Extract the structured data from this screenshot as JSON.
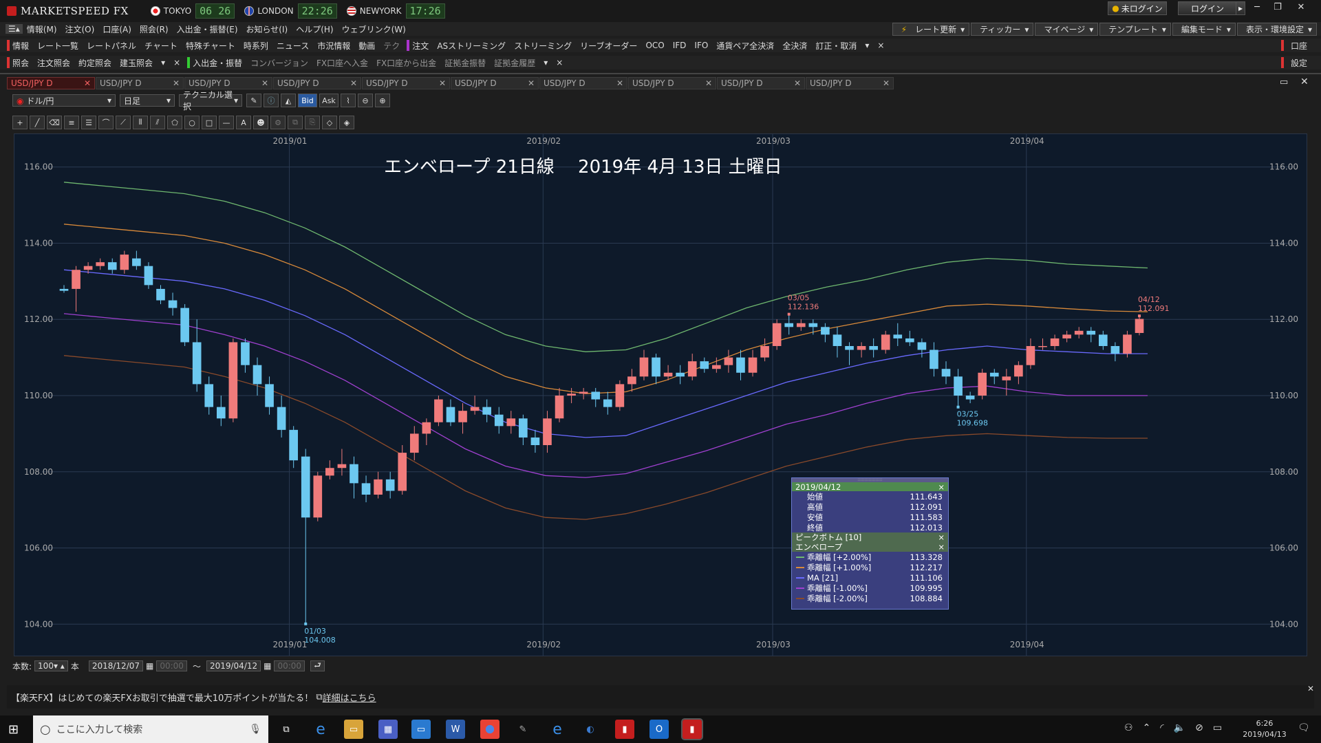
{
  "app": {
    "title": "MARKETSPEED FX"
  },
  "markets": [
    {
      "name": "TOKYO",
      "time": "06 26"
    },
    {
      "name": "LONDON",
      "time": "22:26"
    },
    {
      "name": "NEWYORK",
      "time": "17:26"
    }
  ],
  "top_buttons": {
    "login_status": "未ログイン",
    "login": "ログイン"
  },
  "menu": [
    "情報(M)",
    "注文(O)",
    "口座(A)",
    "照会(R)",
    "入出金・振替(E)",
    "お知らせ(I)",
    "ヘルプ(H)",
    "ウェブリンク(W)"
  ],
  "menu_right": [
    "レート更新",
    "ティッカー",
    "マイページ",
    "テンプレート",
    "編集モード",
    "表示・環境設定"
  ],
  "row1": {
    "info_label": "情報",
    "info_items": [
      "レート一覧",
      "レートパネル",
      "チャート",
      "特殊チャート",
      "時系列",
      "ニュース",
      "市況情報",
      "動画",
      "テク"
    ],
    "order_label": "注文",
    "order_items": [
      "ASストリーミング",
      "ストリーミング",
      "リーブオーダー",
      "OCO",
      "IFD",
      "IFO",
      "通貨ペア全決済",
      "全決済",
      "訂正・取消"
    ],
    "right": "口座"
  },
  "row2": {
    "label": "照会",
    "items": [
      "注文照会",
      "約定照会",
      "建玉照会"
    ],
    "transfer_label": "入出金・振替",
    "transfer_items": [
      "コンバージョン",
      "FX口座へ入金",
      "FX口座から出金",
      "証拠金振替",
      "証拠金履歴"
    ],
    "right": "設定"
  },
  "tabs": [
    "USD/JPY D",
    "USD/JPY D",
    "USD/JPY D",
    "USD/JPY D",
    "USD/JPY D",
    "USD/JPY D",
    "USD/JPY D",
    "USD/JPY D",
    "USD/JPY D",
    "USD/JPY D"
  ],
  "toolbar": {
    "pair": "ドル/円",
    "period": "日足",
    "tech": "テクニカル選択",
    "bid": "Bid",
    "ask": "Ask"
  },
  "chart_title": "エンベロープ 21日線　 2019年 4月 13日 土曜日",
  "chart_data": {
    "type": "candlestick",
    "x_ticks": [
      "2019/01",
      "2019/02",
      "2019/03",
      "2019/04"
    ],
    "y_ticks": [
      "116.00",
      "114.00",
      "112.00",
      "110.00",
      "108.00",
      "106.00",
      "104.00"
    ],
    "ylim": [
      103.5,
      116.5
    ],
    "annotations": [
      {
        "date": "01/03",
        "value": "104.008"
      },
      {
        "date": "03/05",
        "value": "112.136"
      },
      {
        "date": "03/25",
        "value": "109.698"
      },
      {
        "date": "04/12",
        "value": "112.091"
      }
    ],
    "series": [
      {
        "name": "乖離幅 [+2.00%]",
        "color": "#6fb86f",
        "values": [
          115.6,
          115.5,
          115.4,
          115.3,
          115.1,
          114.8,
          114.4,
          113.9,
          113.3,
          112.7,
          112.1,
          111.6,
          111.3,
          111.15,
          111.2,
          111.5,
          111.9,
          112.3,
          112.6,
          112.85,
          113.05,
          113.3,
          113.5,
          113.6,
          113.55,
          113.45,
          113.4,
          113.35
        ]
      },
      {
        "name": "乖離幅 [+1.00%]",
        "color": "#d98a3a",
        "values": [
          114.5,
          114.4,
          114.3,
          114.2,
          114.0,
          113.7,
          113.3,
          112.8,
          112.2,
          111.6,
          111.0,
          110.5,
          110.2,
          110.05,
          110.1,
          110.4,
          110.8,
          111.2,
          111.5,
          111.75,
          111.95,
          112.15,
          112.35,
          112.4,
          112.35,
          112.28,
          112.22,
          112.2
        ]
      },
      {
        "name": "MA [21]",
        "color": "#6a6aff",
        "values": [
          113.3,
          113.2,
          113.1,
          113.0,
          112.8,
          112.5,
          112.1,
          111.6,
          111.0,
          110.4,
          109.8,
          109.3,
          109.0,
          108.9,
          108.95,
          109.3,
          109.65,
          110.0,
          110.35,
          110.6,
          110.85,
          111.05,
          111.2,
          111.3,
          111.2,
          111.15,
          111.1,
          111.1
        ]
      },
      {
        "name": "乖離幅 [-1.00%]",
        "color": "#a040d0",
        "values": [
          112.15,
          112.05,
          111.95,
          111.85,
          111.6,
          111.3,
          110.9,
          110.4,
          109.8,
          109.2,
          108.6,
          108.15,
          107.9,
          107.85,
          107.95,
          108.25,
          108.55,
          108.9,
          109.25,
          109.5,
          109.8,
          110.05,
          110.2,
          110.25,
          110.1,
          110.0,
          110.0,
          110.0
        ]
      },
      {
        "name": "乖離幅 [-2.00%]",
        "color": "#8a4a2a",
        "values": [
          111.05,
          110.95,
          110.85,
          110.75,
          110.5,
          110.2,
          109.8,
          109.3,
          108.7,
          108.1,
          107.5,
          107.05,
          106.8,
          106.75,
          106.9,
          107.15,
          107.45,
          107.8,
          108.15,
          108.4,
          108.65,
          108.85,
          108.95,
          109.0,
          108.95,
          108.9,
          108.88,
          108.88
        ]
      }
    ],
    "candles": [
      [
        112.8,
        112.75,
        112.9,
        112.7
      ],
      [
        112.8,
        113.3,
        113.4,
        112.2
      ],
      [
        113.3,
        113.4,
        113.5,
        113.2
      ],
      [
        113.4,
        113.5,
        113.6,
        113.3
      ],
      [
        113.5,
        113.3,
        113.6,
        113.2
      ],
      [
        113.3,
        113.7,
        113.8,
        113.2
      ],
      [
        113.6,
        113.4,
        113.8,
        113.3
      ],
      [
        113.4,
        112.9,
        113.5,
        112.8
      ],
      [
        112.8,
        112.5,
        112.9,
        112.4
      ],
      [
        112.5,
        112.3,
        112.7,
        112.1
      ],
      [
        112.3,
        111.4,
        112.4,
        111.3
      ],
      [
        111.4,
        110.3,
        112.0,
        110.1
      ],
      [
        110.3,
        109.7,
        110.5,
        109.5
      ],
      [
        109.7,
        109.4,
        110.0,
        109.2
      ],
      [
        109.4,
        111.4,
        111.5,
        109.3
      ],
      [
        111.4,
        110.8,
        111.5,
        110.6
      ],
      [
        110.8,
        110.3,
        111.0,
        110.0
      ],
      [
        110.3,
        109.7,
        110.5,
        109.5
      ],
      [
        109.7,
        109.1,
        110.0,
        108.9
      ],
      [
        109.1,
        108.3,
        109.2,
        108.1
      ],
      [
        108.4,
        106.8,
        108.6,
        104.0
      ],
      [
        106.8,
        107.9,
        108.0,
        106.7
      ],
      [
        107.9,
        108.1,
        108.3,
        107.8
      ],
      [
        108.1,
        108.2,
        108.6,
        107.9
      ],
      [
        108.2,
        107.7,
        108.4,
        107.3
      ],
      [
        107.7,
        107.4,
        107.9,
        107.2
      ],
      [
        107.4,
        107.8,
        108.0,
        107.3
      ],
      [
        107.8,
        107.5,
        108.0,
        107.3
      ],
      [
        107.5,
        108.5,
        108.7,
        107.4
      ],
      [
        108.5,
        109.0,
        109.2,
        108.3
      ],
      [
        109.0,
        109.3,
        109.4,
        108.7
      ],
      [
        109.3,
        109.9,
        110.0,
        109.2
      ],
      [
        109.7,
        109.3,
        109.9,
        109.2
      ],
      [
        109.3,
        109.6,
        109.8,
        109.0
      ],
      [
        109.6,
        109.7,
        110.0,
        109.5
      ],
      [
        109.7,
        109.5,
        109.9,
        109.3
      ],
      [
        109.5,
        109.2,
        109.7,
        109.0
      ],
      [
        109.2,
        109.4,
        109.6,
        109.0
      ],
      [
        109.4,
        108.9,
        109.5,
        108.7
      ],
      [
        108.9,
        108.7,
        109.1,
        108.5
      ],
      [
        108.7,
        109.4,
        109.6,
        108.5
      ],
      [
        109.4,
        110.0,
        110.2,
        109.3
      ],
      [
        110.0,
        110.05,
        110.2,
        109.8
      ],
      [
        110.05,
        110.1,
        110.2,
        109.9
      ],
      [
        110.1,
        109.9,
        110.2,
        109.7
      ],
      [
        109.9,
        109.7,
        110.1,
        109.5
      ],
      [
        109.7,
        110.3,
        110.4,
        109.6
      ],
      [
        110.3,
        110.5,
        110.7,
        110.1
      ],
      [
        110.5,
        111.0,
        111.2,
        110.4
      ],
      [
        111.0,
        110.5,
        111.1,
        110.3
      ],
      [
        110.5,
        110.6,
        110.8,
        110.4
      ],
      [
        110.6,
        110.5,
        110.8,
        110.3
      ],
      [
        110.5,
        110.9,
        111.1,
        110.4
      ],
      [
        110.9,
        110.7,
        111.0,
        110.6
      ],
      [
        110.7,
        110.8,
        111.0,
        110.6
      ],
      [
        110.8,
        111.0,
        111.2,
        110.6
      ],
      [
        111.0,
        110.6,
        111.2,
        110.4
      ],
      [
        110.6,
        111.0,
        111.2,
        110.5
      ],
      [
        111.0,
        111.3,
        111.5,
        110.9
      ],
      [
        111.3,
        111.9,
        112.0,
        111.2
      ],
      [
        111.9,
        111.8,
        112.136,
        111.6
      ],
      [
        111.8,
        111.9,
        112.0,
        111.7
      ],
      [
        111.9,
        111.8,
        112.0,
        111.6
      ],
      [
        111.8,
        111.6,
        111.9,
        111.4
      ],
      [
        111.6,
        111.3,
        111.8,
        111.0
      ],
      [
        111.3,
        111.2,
        111.4,
        110.8
      ],
      [
        111.2,
        111.3,
        111.4,
        111.0
      ],
      [
        111.3,
        111.2,
        111.5,
        111.0
      ],
      [
        111.2,
        111.6,
        111.7,
        111.1
      ],
      [
        111.6,
        111.5,
        111.9,
        111.3
      ],
      [
        111.5,
        111.4,
        111.7,
        111.3
      ],
      [
        111.4,
        111.2,
        111.5,
        111.0
      ],
      [
        111.2,
        110.7,
        111.4,
        110.5
      ],
      [
        110.7,
        110.5,
        110.9,
        110.3
      ],
      [
        110.5,
        110.0,
        110.7,
        109.698
      ],
      [
        110.0,
        109.9,
        110.1,
        109.8
      ],
      [
        110.0,
        110.6,
        110.7,
        109.9
      ],
      [
        110.6,
        110.5,
        110.7,
        110.3
      ],
      [
        110.4,
        110.5,
        110.7,
        110.0
      ],
      [
        110.5,
        110.8,
        110.9,
        110.3
      ],
      [
        110.8,
        111.3,
        111.5,
        110.7
      ],
      [
        111.3,
        111.3,
        111.5,
        111.2
      ],
      [
        111.3,
        111.5,
        111.6,
        111.2
      ],
      [
        111.5,
        111.6,
        111.7,
        111.4
      ],
      [
        111.6,
        111.7,
        111.8,
        111.5
      ],
      [
        111.7,
        111.6,
        111.8,
        111.4
      ],
      [
        111.6,
        111.3,
        111.7,
        111.2
      ],
      [
        111.3,
        111.1,
        111.4,
        110.9
      ],
      [
        111.1,
        111.6,
        111.7,
        111.0
      ],
      [
        111.643,
        112.013,
        112.091,
        111.583
      ]
    ]
  },
  "popup": {
    "date": "2019/04/12",
    "rows": [
      {
        "k": "始値",
        "v": "111.643"
      },
      {
        "k": "高値",
        "v": "112.091"
      },
      {
        "k": "安値",
        "v": "111.583"
      },
      {
        "k": "終値",
        "v": "112.013"
      }
    ],
    "group1": "ピークボトム [10]",
    "group2": "エンベロープ",
    "lines": [
      {
        "k": "乖離幅 [+2.00%]",
        "v": "113.328",
        "color": "#6fb86f"
      },
      {
        "k": "乖離幅 [+1.00%]",
        "v": "112.217",
        "color": "#d98a3a"
      },
      {
        "k": "MA [21]",
        "v": "111.106",
        "color": "#6a6aff"
      },
      {
        "k": "乖離幅 [-1.00%]",
        "v": "109.995",
        "color": "#a040d0"
      },
      {
        "k": "乖離幅 [-2.00%]",
        "v": "108.884",
        "color": "#8a4a2a"
      }
    ]
  },
  "bottom": {
    "count_label": "本数:",
    "count": "100",
    "unit": "本",
    "from": "2018/12/07",
    "from_time": "00:00",
    "tilde": "～",
    "to": "2019/04/12",
    "to_time": "00:00"
  },
  "news": {
    "text": "【楽天FX】はじめての楽天FXお取引で抽選で最大10万ポイントが当たる！",
    "link": "詳細はこちら"
  },
  "taskbar": {
    "search": "ここに入力して検索",
    "time": "6:26",
    "date": "2019/04/13"
  }
}
